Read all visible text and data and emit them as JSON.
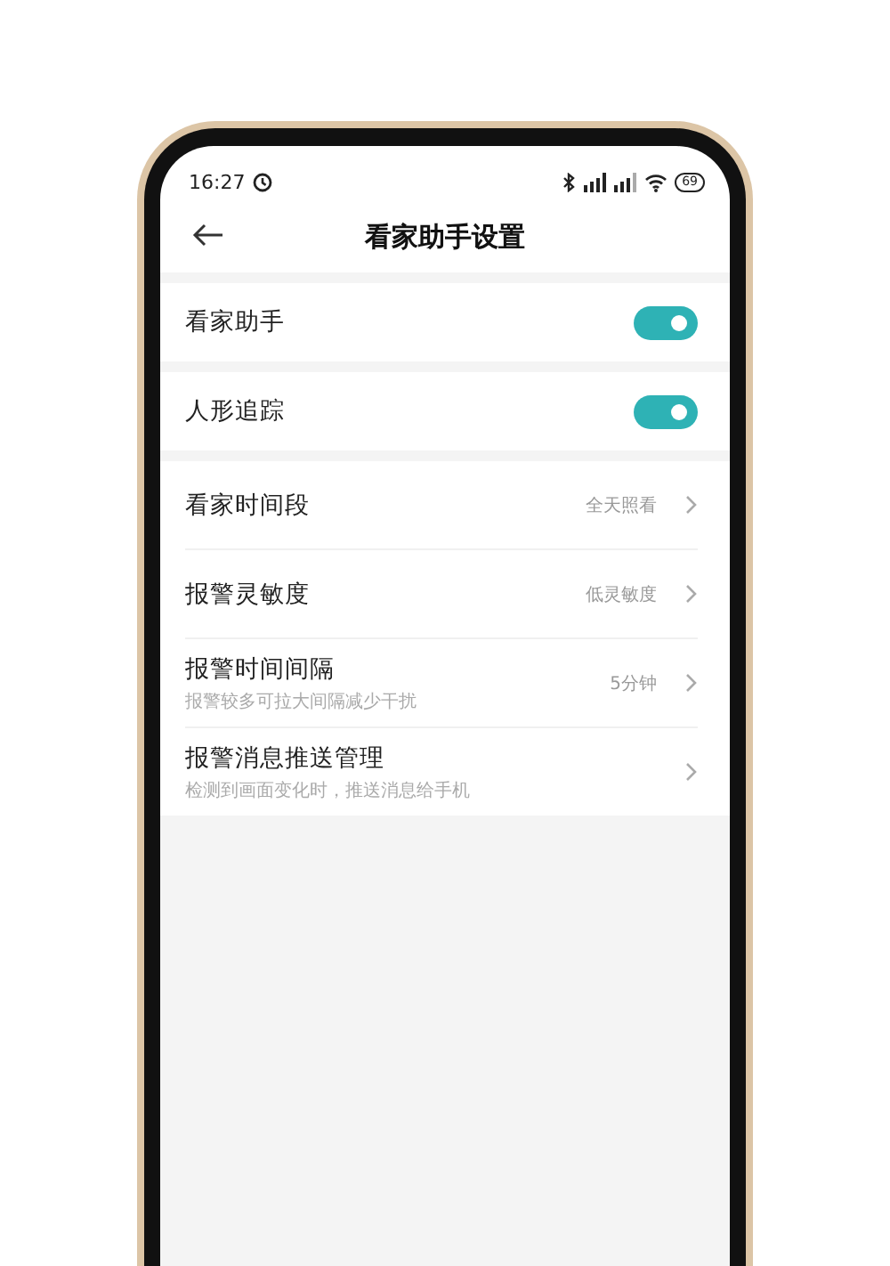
{
  "status_bar": {
    "time": "16:27",
    "battery": "69"
  },
  "header": {
    "title": "看家助手设置"
  },
  "groups": [
    {
      "items": [
        {
          "kind": "toggle",
          "label": "看家助手",
          "on": true
        }
      ]
    },
    {
      "items": [
        {
          "kind": "toggle",
          "label": "人形追踪",
          "on": true
        }
      ]
    },
    {
      "items": [
        {
          "kind": "link",
          "label": "看家时间段",
          "value": "全天照看"
        },
        {
          "kind": "link",
          "label": "报警灵敏度",
          "value": "低灵敏度"
        },
        {
          "kind": "link",
          "label": "报警时间间隔",
          "description": "报警较多可拉大间隔减少干扰",
          "value": "5分钟"
        },
        {
          "kind": "link",
          "label": "报警消息推送管理",
          "description": "检测到画面变化时，推送消息给手机"
        }
      ]
    }
  ]
}
